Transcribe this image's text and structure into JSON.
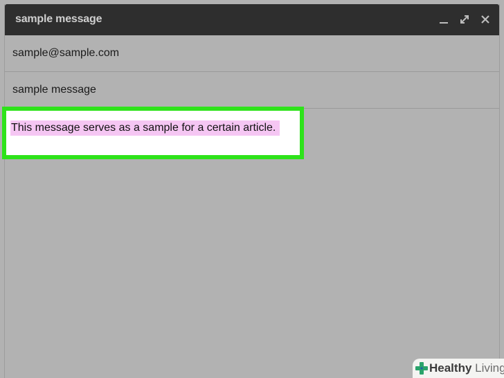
{
  "window": {
    "title": "sample message",
    "controls": {
      "minimize_icon": "minimize-icon",
      "expand_icon": "expand-icon",
      "close_icon": "close-icon"
    }
  },
  "fields": {
    "to_value": "sample@sample.com",
    "subject_value": "sample message"
  },
  "body": {
    "text": "This message serves as a sample for a certain article."
  },
  "watermark": {
    "brand_bold": "Healthy",
    "brand_light": "Living"
  },
  "colors": {
    "titlebar": "#2e2e2e",
    "background": "#b2b2b2",
    "highlight_border": "#2ee31a",
    "text_selection": "#f5c6f3",
    "watermark_cross": "#2aa36b"
  }
}
